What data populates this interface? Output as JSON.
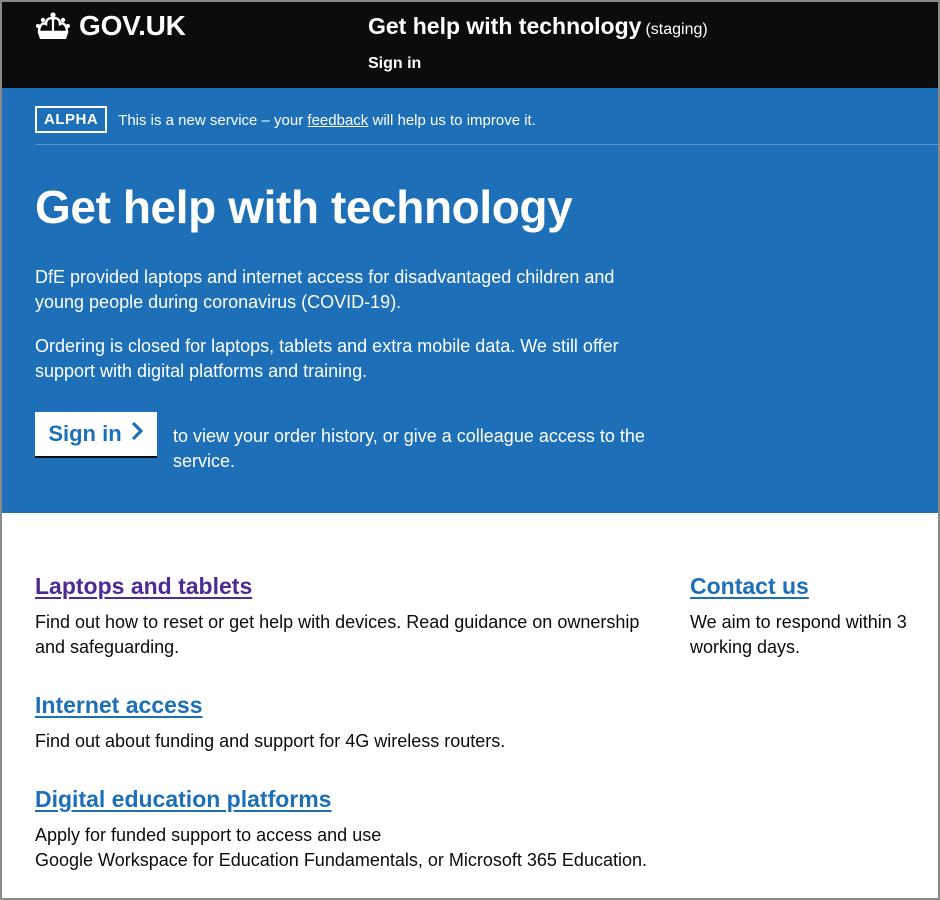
{
  "header": {
    "logo_text": "GOV.UK",
    "service_name": "Get help with technology",
    "environment": "(staging)",
    "sign_in": "Sign in"
  },
  "phase_banner": {
    "tag": "ALPHA",
    "text_before": "This is a new service – your",
    "link": "feedback",
    "text_after": "will help us to improve it."
  },
  "hero": {
    "title": "Get help with technology",
    "paragraph1": "DfE provided laptops and internet access for disadvantaged children and young people during coronavirus (COVID-19).",
    "paragraph2": "Ordering is closed for laptops, tablets and extra mobile data. We still offer support with digital platforms and training.",
    "button_label": "Sign in",
    "button_after": "to view your order history, or give a colleague access to the service."
  },
  "sections": [
    {
      "title": "Laptops and tablets",
      "text": "Find out how to reset or get help with devices. Read guidance on ownership and safeguarding."
    },
    {
      "title": "Internet access",
      "text": "Find out about funding and support for 4G wireless routers."
    },
    {
      "title": "Digital education platforms",
      "text_line1": "Apply for funded support to access and use",
      "text_line2": "Google Workspace for Education Fundamentals, or Microsoft 365 Education."
    }
  ],
  "contact": {
    "title": "Contact us",
    "text": "We aim to respond within 3 working days."
  },
  "colors": {
    "header_bg": "#0b0c0c",
    "brand_blue": "#1d70b8",
    "visited_link": "#4c2c92",
    "text": "#0b0c0c"
  },
  "icons": {
    "logo": "crown-icon",
    "button": "chevron-right-icon"
  }
}
